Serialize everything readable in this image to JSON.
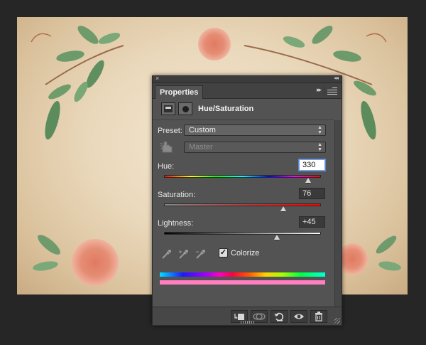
{
  "panel": {
    "close_glyph": "×",
    "collapse_glyph": "◂◂",
    "tab_label": "Properties",
    "more_glyph": "▸▸",
    "adjustment_title": "Hue/Saturation"
  },
  "preset": {
    "label": "Preset:",
    "value": "Custom"
  },
  "channel": {
    "value": "Master"
  },
  "hue": {
    "label": "Hue:",
    "value": "330",
    "level_fraction": 0.92
  },
  "saturation": {
    "label": "Saturation:",
    "value": "76",
    "level_fraction": 0.76
  },
  "lightness": {
    "label": "Lightness:",
    "value": "+45",
    "level_fraction": 0.72
  },
  "colorize": {
    "label": "Colorize",
    "checked": true,
    "check_glyph": "✓"
  },
  "colors": {
    "panel_bg": "#535353",
    "result_bar": "#ff7fc0",
    "accent_input": "#5b86d6"
  },
  "icons": {
    "clip": "clip-to-layer-icon",
    "view_previous": "view-previous-state-icon",
    "reset": "reset-icon",
    "visibility": "eye-icon",
    "delete": "trash-icon"
  }
}
